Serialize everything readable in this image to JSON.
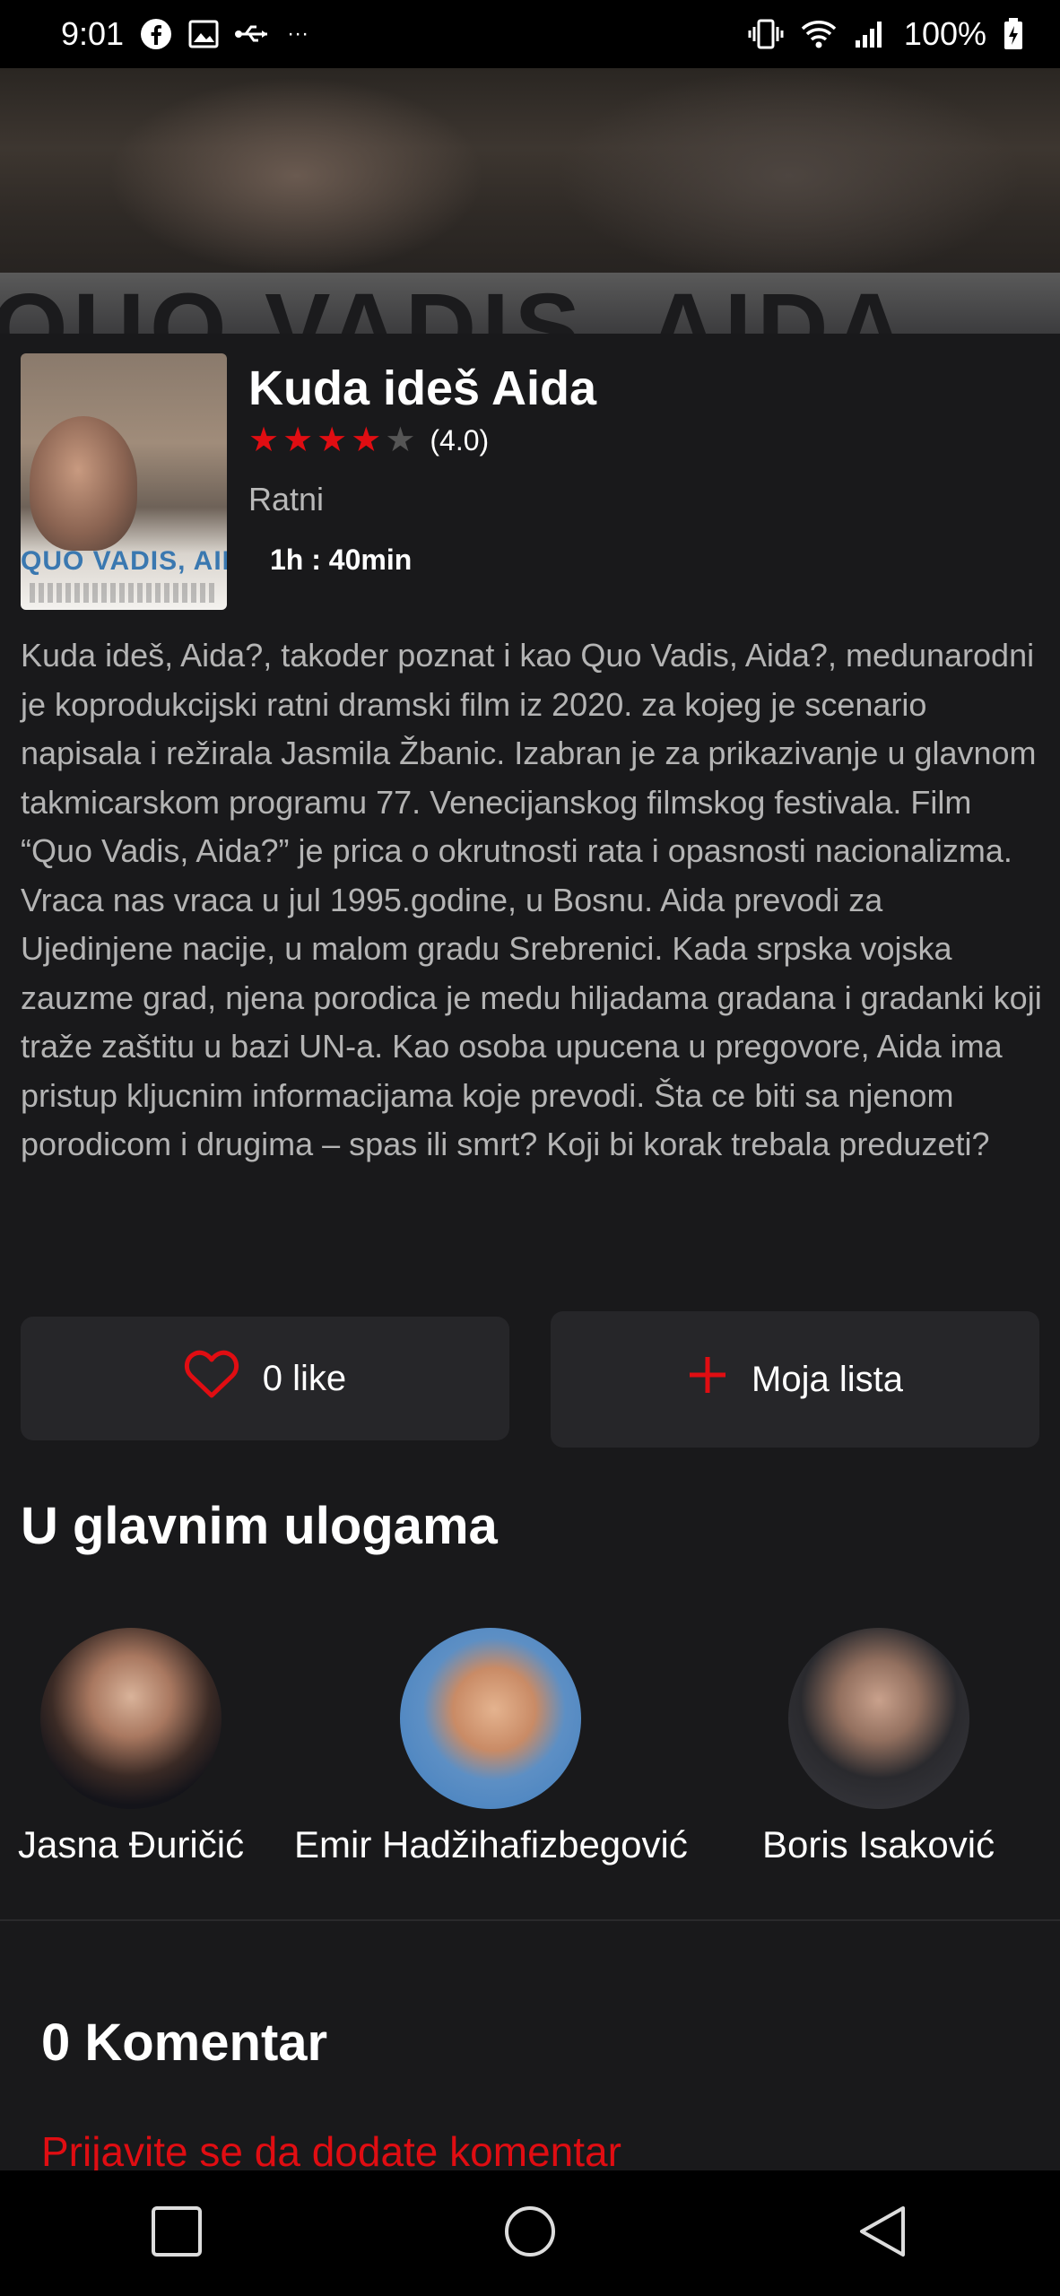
{
  "status_bar": {
    "time": "9:01",
    "battery": "100%",
    "left_icons": [
      "facebook-icon",
      "image-icon",
      "usb-icon",
      "more-dots-icon"
    ],
    "right_icons": [
      "vibrate-icon",
      "wifi-icon",
      "signal-icon",
      "battery-icon"
    ]
  },
  "hero": {
    "backdrop_text": "QUO VADIS, AIDA"
  },
  "movie": {
    "title": "Kuda ideš Aida",
    "rating": 4.0,
    "rating_text": "(4.0)",
    "genre": "Ratni",
    "duration": "1h : 40min",
    "poster_text": "QUO VADIS, AIDA",
    "description": "Kuda ideš, Aida?, takoder poznat i kao Quo Vadis, Aida?, medunarodni je koprodukcijski ratni dramski film iz 2020. za kojeg je scenario napisala i režirala Jasmila Žbanic. Izabran je za prikazivanje u glavnom takmicarskom programu 77. Venecijanskog filmskog festivala. Film “Quo Vadis, Aida?” je prica o okrutnosti rata i opasnosti nacionalizma. Vraca nas vraca u jul 1995.godine, u Bosnu. Aida prevodi za Ujedinjene nacije, u malom gradu Srebrenici. Kada srpska vojska zauzme grad, njena porodica je medu hiljadama gradana i gradanki koji traže zaštitu u bazi UN-a. Kao osoba upucena u pregovore, Aida ima pristup kljucnim informacijama koje prevodi. Šta ce biti sa njenom porodicom i drugima – spas ili smrt? Koji bi korak trebala preduzeti?"
  },
  "actions": {
    "like_label": "0 like",
    "list_label": "Moja lista"
  },
  "cast": {
    "title": "U glavnim ulogama",
    "members": [
      {
        "name": "Jasna Đuričić"
      },
      {
        "name": "Emir Hadžihafizbegović"
      },
      {
        "name": "Boris Isaković"
      }
    ]
  },
  "comments": {
    "title": "0 Komentar",
    "login_prompt": "Prijavite se da dodate komentar"
  },
  "colors": {
    "accent": "#e00d12",
    "background": "#19191b",
    "button_bg": "#262629"
  }
}
